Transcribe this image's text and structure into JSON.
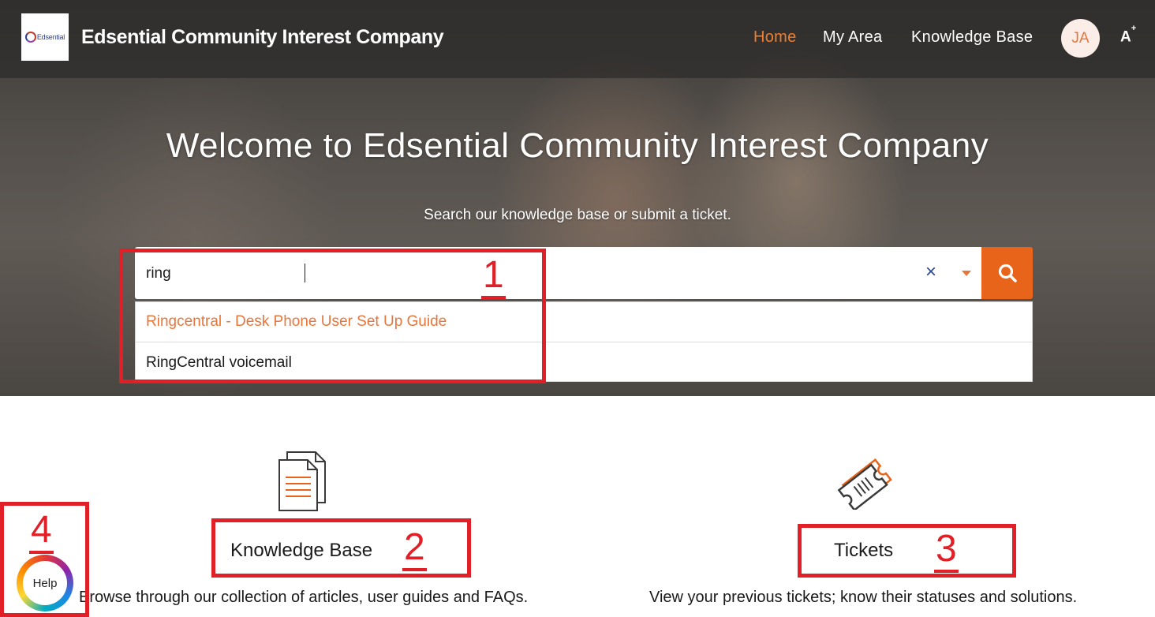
{
  "header": {
    "logo_text": "Edsential",
    "brand": "Edsential Community Interest Company",
    "nav": [
      {
        "label": "Home",
        "active": true
      },
      {
        "label": "My Area",
        "active": false
      },
      {
        "label": "Knowledge Base",
        "active": false
      }
    ],
    "avatar_initials": "JA",
    "accessibility_label": "A",
    "accessibility_superscript": "+"
  },
  "hero": {
    "title": "Welcome to Edsential Community Interest Company",
    "subtitle": "Search our knowledge base or submit a ticket."
  },
  "search": {
    "value": "ring",
    "clear_symbol": "×",
    "icons": {
      "clear": "close-icon",
      "dropdown": "caret-down-icon",
      "submit": "search-icon"
    },
    "suggestions": [
      "Ringcentral - Desk Phone User Set Up Guide",
      "RingCentral voicemail"
    ]
  },
  "cards": [
    {
      "title": "Knowledge Base",
      "description": "Browse through our collection of articles, user guides and FAQs.",
      "icon": "documents-icon"
    },
    {
      "title": "Tickets",
      "description": "View your previous tickets; know their statuses and solutions.",
      "icon": "ticket-icon"
    }
  ],
  "help": {
    "label": "Help"
  },
  "annotations": [
    "1",
    "2",
    "3",
    "4"
  ],
  "colors": {
    "accent": "#e8641b",
    "annotation_red": "#e01f26",
    "nav_active": "#f07f2d"
  }
}
